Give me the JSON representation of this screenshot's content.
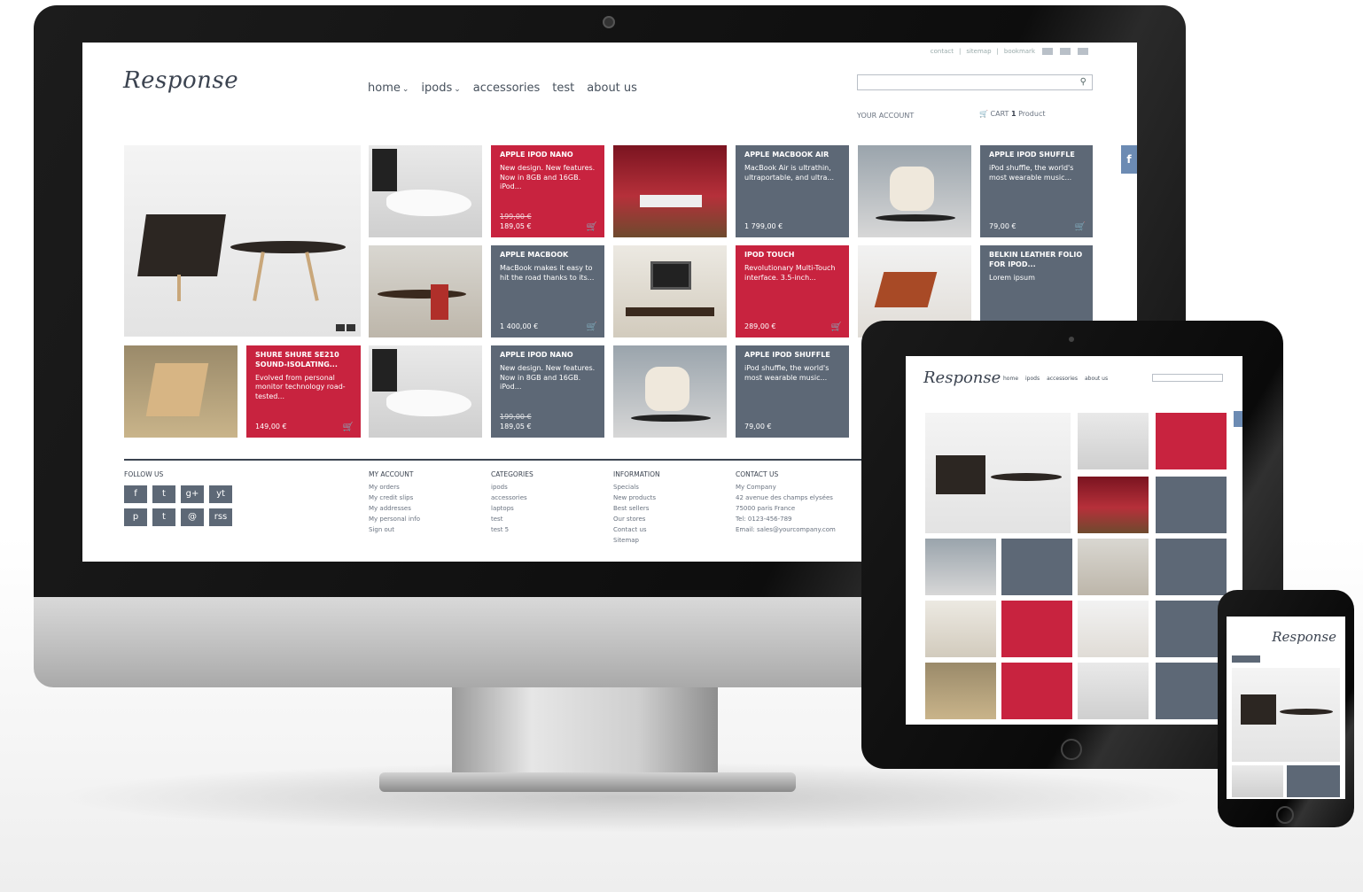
{
  "site": {
    "logo": "Response",
    "top_links": [
      "contact",
      "sitemap",
      "bookmark"
    ],
    "nav": [
      {
        "label": "home",
        "has_menu": true
      },
      {
        "label": "ipods",
        "has_menu": true
      },
      {
        "label": "accessories",
        "has_menu": false
      },
      {
        "label": "test",
        "has_menu": false
      },
      {
        "label": "about us",
        "has_menu": false
      }
    ],
    "search_placeholder": "",
    "your_account": "YOUR ACCOUNT",
    "cart_label": "CART",
    "cart_count": "1",
    "cart_unit": "Product",
    "facebook_tab": "f"
  },
  "products": [
    {
      "title": "APPLE IPOD NANO",
      "desc": "New design. New features. Now in 8GB and 16GB. iPod...",
      "old_price": "199,00 €",
      "price": "189,05 €",
      "color": "red"
    },
    {
      "title": "APPLE MACBOOK AIR",
      "desc": "MacBook Air is ultrathin, ultraportable, and ultra...",
      "old_price": "",
      "price": "1 799,00 €",
      "color": "slate"
    },
    {
      "title": "APPLE IPOD SHUFFLE",
      "desc": "iPod shuffle, the world's most wearable music...",
      "old_price": "",
      "price": "79,00 €",
      "color": "slate"
    },
    {
      "title": "APPLE MACBOOK",
      "desc": "MacBook makes it easy to hit the road thanks to its...",
      "old_price": "",
      "price": "1 400,00 €",
      "color": "slate"
    },
    {
      "title": "IPOD TOUCH",
      "desc": "Revolutionary Multi-Touch interface. 3.5-inch...",
      "old_price": "",
      "price": "289,00 €",
      "color": "red"
    },
    {
      "title": "BELKIN LEATHER FOLIO FOR IPOD...",
      "desc": "Lorem ipsum",
      "old_price": "",
      "price": "",
      "color": "slate"
    },
    {
      "title": "SHURE SHURE SE210 SOUND-ISOLATING...",
      "desc": "Evolved from personal monitor technology road-tested...",
      "old_price": "",
      "price": "149,00 €",
      "color": "red"
    },
    {
      "title": "APPLE IPOD NANO",
      "desc": "New design. New features. Now in 8GB and 16GB. iPod...",
      "old_price": "199,00 €",
      "price": "189,05 €",
      "color": "slate"
    },
    {
      "title": "APPLE IPOD SHUFFLE",
      "desc": "iPod shuffle, the world's most wearable music...",
      "old_price": "",
      "price": "79,00 €",
      "color": "slate"
    }
  ],
  "footer": {
    "follow_us": "FOLLOW US",
    "social": [
      "f",
      "t",
      "g+",
      "yt",
      "p",
      "t",
      "@",
      "rss"
    ],
    "my_account": {
      "title": "MY ACCOUNT",
      "links": [
        "My orders",
        "My credit slips",
        "My addresses",
        "My personal info",
        "Sign out"
      ]
    },
    "categories": {
      "title": "CATEGORIES",
      "links": [
        "ipods",
        "accessories",
        "laptops",
        "test",
        "test 5"
      ]
    },
    "information": {
      "title": "INFORMATION",
      "links": [
        "Specials",
        "New products",
        "Best sellers",
        "Our stores",
        "Contact us",
        "Sitemap"
      ]
    },
    "contact": {
      "title": "CONTACT US",
      "lines": [
        "My Company",
        "42 avenue des champs elysées",
        "75000 paris France",
        "Tel: 0123-456-789",
        "Email: sales@yourcompany.com"
      ]
    }
  },
  "tablet": {
    "logo": "Response",
    "nav": [
      "home",
      "ipods",
      "accessories",
      "about us"
    ]
  },
  "phone": {
    "logo": "Response"
  },
  "colors": {
    "red": "#c8233f",
    "slate": "#5d6876",
    "dark": "#3b4350"
  }
}
